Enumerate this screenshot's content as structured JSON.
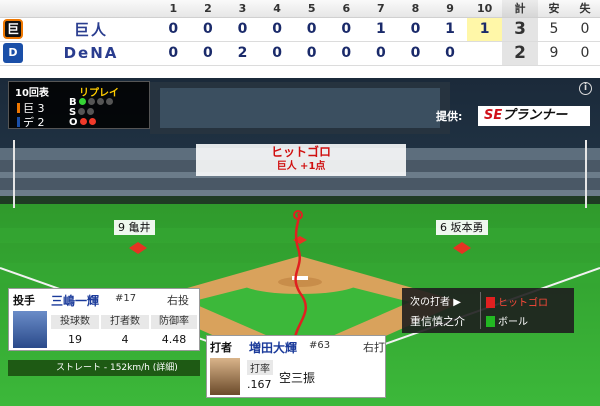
{
  "scoreboard": {
    "innings": [
      "1",
      "2",
      "3",
      "4",
      "5",
      "6",
      "7",
      "8",
      "9",
      "10"
    ],
    "total_label": "計",
    "hits_label": "安",
    "errors_label": "失",
    "teams": [
      {
        "logo": "巨",
        "name": "巨人",
        "scores": [
          "0",
          "0",
          "0",
          "0",
          "0",
          "0",
          "1",
          "0",
          "1",
          "1"
        ],
        "total": "3",
        "hits": "5",
        "errors": "0"
      },
      {
        "logo": "D",
        "name": "DeNA",
        "scores": [
          "0",
          "0",
          "2",
          "0",
          "0",
          "0",
          "0",
          "0",
          "0",
          ""
        ],
        "total": "2",
        "hits": "9",
        "errors": "0"
      }
    ]
  },
  "count": {
    "inning": "10回表",
    "mode": "リプレイ",
    "away": "巨 3",
    "home": "デ 2",
    "b": "B",
    "s": "S",
    "o": "O",
    "colors": {
      "giants": "#ee7700",
      "dena": "#1a4fa8"
    }
  },
  "sponsor": {
    "label": "提供:",
    "brand_prefix": "SE",
    "brand_rest": "プランナー"
  },
  "info_icon": "info-icon",
  "play": {
    "result": "ヒットゴロ",
    "detail": "巨人 +1点"
  },
  "fielders": {
    "left": "9 亀井",
    "right": "6 坂本勇"
  },
  "pitcher": {
    "role": "投手",
    "name": "三嶋一輝",
    "number": "#17",
    "throws": "右投",
    "headers": [
      "投球数",
      "打者数",
      "防御率"
    ],
    "values": [
      "19",
      "4",
      "4.48"
    ],
    "last_pitch": "ストレート - 152km/h",
    "detail_link": "(詳細)"
  },
  "batter": {
    "role": "打者",
    "name": "増田大輝",
    "number": "#63",
    "bats": "右打",
    "avg_label": "打率",
    "avg": ".167",
    "result": "空三振"
  },
  "next_batter": {
    "label": "次の打者",
    "arrow": "▶",
    "name": "重信慎之介"
  },
  "legend": [
    {
      "label": "ヒットゴロ",
      "color": "#e02020"
    },
    {
      "label": "ボール",
      "color": "#22b822"
    }
  ]
}
